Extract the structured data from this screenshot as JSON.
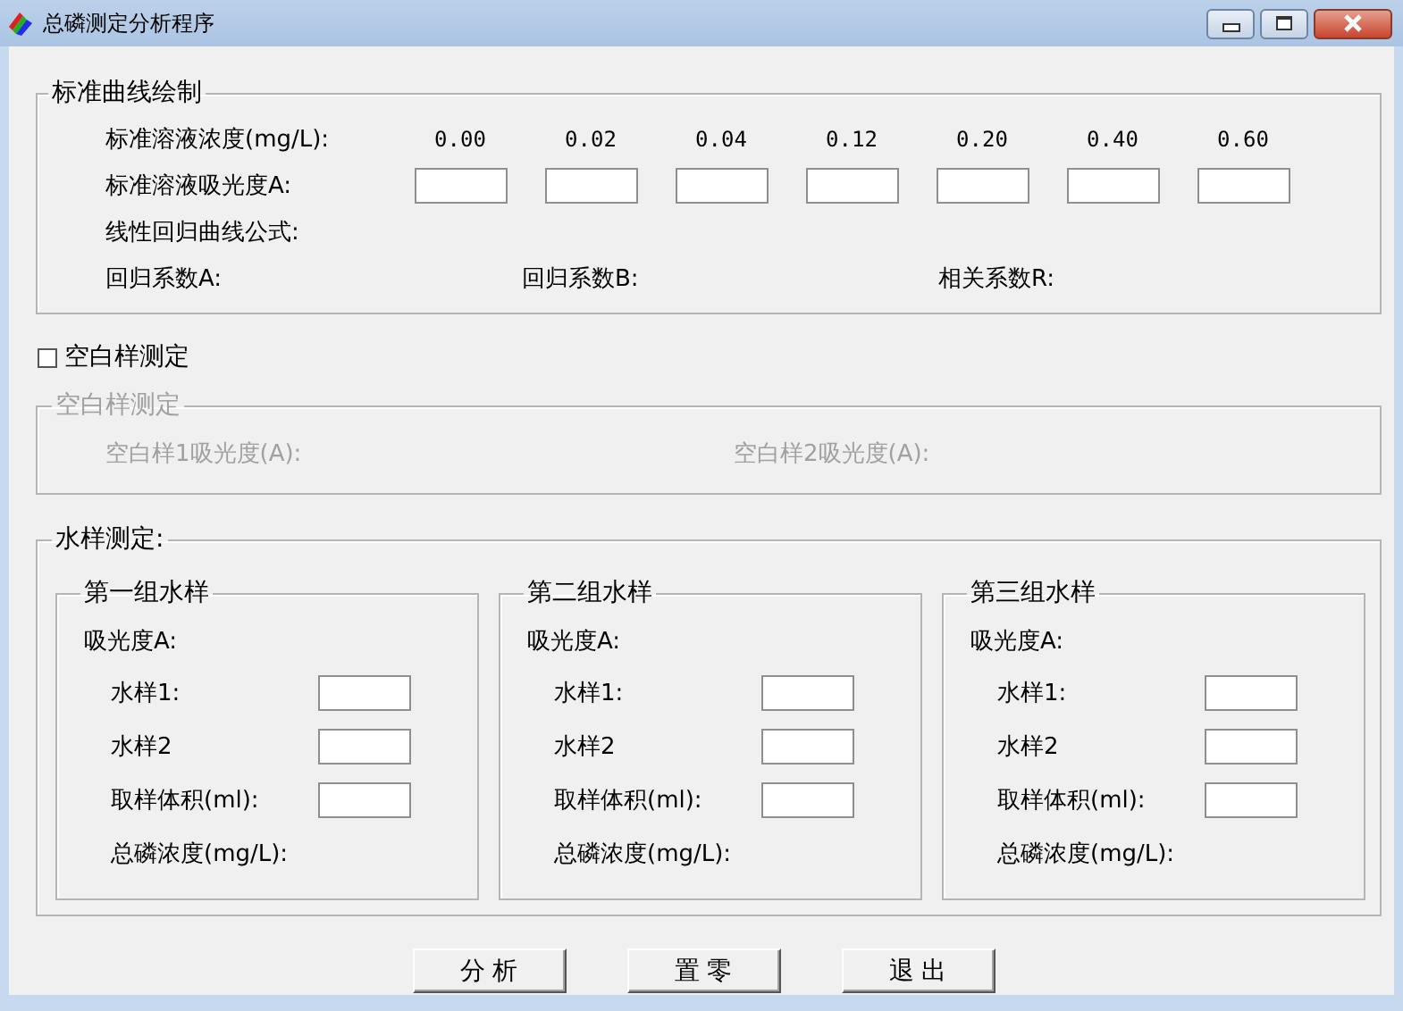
{
  "window": {
    "title": "总磷测定分析程序"
  },
  "standard_curve": {
    "title": "标准曲线绘制",
    "concentration_label": "标准溶液浓度(mg/L):",
    "concentrations": [
      {
        "value": "0.00"
      },
      {
        "value": "0.02"
      },
      {
        "value": "0.04"
      },
      {
        "value": "0.12"
      },
      {
        "value": "0.20"
      },
      {
        "value": "0.40"
      },
      {
        "value": "0.60"
      }
    ],
    "absorbance_label": "标准溶液吸光度A:",
    "formula_label": "线性回归曲线公式:",
    "coefficients": [
      "回归系数A:",
      "回归系数B:",
      "相关系数R:"
    ]
  },
  "blank_checkbox": {
    "label": "空白样测定",
    "checked": false
  },
  "blank_group": {
    "title": "空白样测定",
    "fields": [
      "空白样1吸光度(A):",
      "空白样2吸光度(A):"
    ]
  },
  "water_group": {
    "title": "水样测定:",
    "groups": [
      {
        "title": "第一组水样",
        "absorbance_label": "吸光度A:",
        "fields": [
          "水样1:",
          "水样2",
          "取样体积(ml):"
        ],
        "result_label": "总磷浓度(mg/L):"
      },
      {
        "title": "第二组水样",
        "absorbance_label": "吸光度A:",
        "fields": [
          "水样1:",
          "水样2",
          "取样体积(ml):"
        ],
        "result_label": "总磷浓度(mg/L):"
      },
      {
        "title": "第三组水样",
        "absorbance_label": "吸光度A:",
        "fields": [
          "水样1:",
          "水样2",
          "取样体积(ml):"
        ],
        "result_label": "总磷浓度(mg/L):"
      }
    ]
  },
  "buttons": [
    "分 析",
    "置 零",
    "退 出"
  ]
}
